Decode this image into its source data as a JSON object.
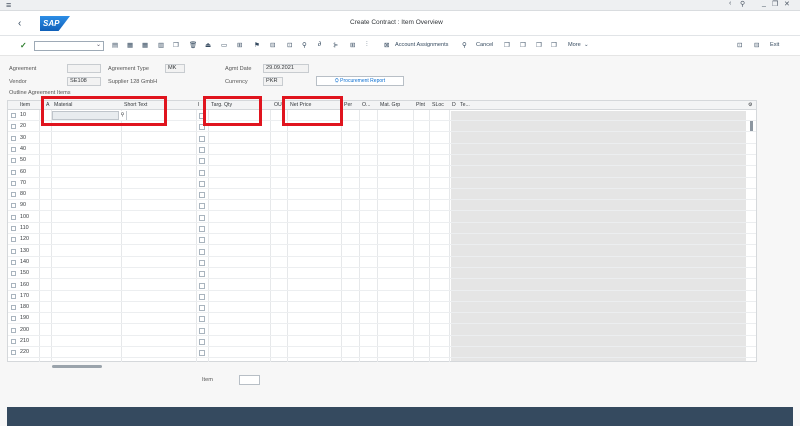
{
  "window": {
    "title": "Create Contract : Item Overview",
    "controls": [
      "<",
      "⚲",
      "_",
      "□",
      "×"
    ]
  },
  "logo_text": "SAP",
  "toolbar": {
    "account_assignments": "Account Assignments",
    "cancel": "Cancel",
    "more": "More"
  },
  "header": {
    "agreement_label": "Agreement",
    "agreement_value": "",
    "agreement_type_label": "Agreement Type",
    "agreement_type_value": "MK",
    "agmt_date_label": "Agmt Date",
    "agmt_date_value": "29.09.2021",
    "vendor_label": "Vendor",
    "vendor_value": "SE108",
    "vendor_name": "Supplier 128 GmbH",
    "currency_label": "Currency",
    "currency_value": "PKR",
    "procurement_report": "Procurement Report",
    "outline_items_label": "Outline Agreement Items"
  },
  "table": {
    "columns": [
      "Item",
      "A",
      "Material",
      "Short Text",
      "I",
      "Targ. Qty",
      "OU",
      "Net Price",
      "Per",
      "O...",
      "Mat. Grp",
      "Plnt",
      "SLoc",
      "D",
      "Te..."
    ],
    "rows": [
      "10",
      "20",
      "30",
      "40",
      "50",
      "60",
      "70",
      "80",
      "90",
      "100",
      "110",
      "120",
      "130",
      "140",
      "150",
      "160",
      "170",
      "180",
      "190",
      "200",
      "210",
      "220"
    ]
  },
  "footer": {
    "item_label": "Item",
    "item_value": ""
  },
  "top_right": {
    "exit": "Exit"
  }
}
